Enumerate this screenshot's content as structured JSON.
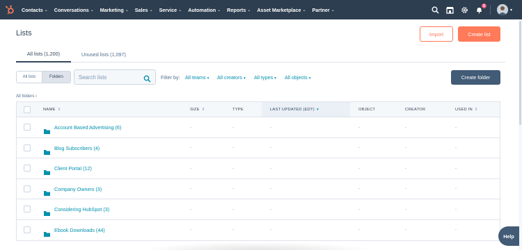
{
  "nav": {
    "items": [
      {
        "label": "Contacts",
        "id": "contacts"
      },
      {
        "label": "Conversations",
        "id": "conversations"
      },
      {
        "label": "Marketing",
        "id": "marketing"
      },
      {
        "label": "Sales",
        "id": "sales"
      },
      {
        "label": "Service",
        "id": "service"
      },
      {
        "label": "Automation",
        "id": "automation"
      },
      {
        "label": "Reports",
        "id": "reports"
      },
      {
        "label": "Asset Marketplace",
        "id": "asset-marketplace"
      },
      {
        "label": "Partner",
        "id": "partner"
      }
    ],
    "notification_count": "6",
    "brand_color": "#2d3e50",
    "accent_color": "#ff7a59"
  },
  "page": {
    "title": "Lists",
    "import_label": "Import",
    "create_list_label": "Create list"
  },
  "tabs": {
    "all": "All lists (1,200)",
    "unused": "Unused lists (1,097)"
  },
  "toolbar": {
    "view_lists": "All lists",
    "view_folders": "Folders",
    "search_placeholder": "Search lists",
    "filter_label": "Filter by:",
    "filters": [
      "All teams",
      "All creators",
      "All types",
      "All objects"
    ],
    "create_folder_label": "Create folder"
  },
  "breadcrumb": "All folders",
  "table": {
    "columns": {
      "name": "NAME",
      "size": "SIZE",
      "type": "TYPE",
      "updated": "LAST UPDATED (EDT)",
      "object": "OBJECT",
      "creator": "CREATOR",
      "used_in": "USED IN"
    },
    "rows": [
      {
        "name": "Account Based Advertising (6)",
        "size": "-",
        "type": "-",
        "updated": "-",
        "object": "-",
        "creator": "-",
        "used_in": "-"
      },
      {
        "name": "Blog Subscribers (4)",
        "size": "-",
        "type": "-",
        "updated": "-",
        "object": "-",
        "creator": "-",
        "used_in": "-"
      },
      {
        "name": "Client Portal (12)",
        "size": "-",
        "type": "-",
        "updated": "-",
        "object": "-",
        "creator": "-",
        "used_in": "-"
      },
      {
        "name": "Company Owners (3)",
        "size": "-",
        "type": "-",
        "updated": "-",
        "object": "-",
        "creator": "-",
        "used_in": "-"
      },
      {
        "name": "Considering HubSpot (3)",
        "size": "-",
        "type": "-",
        "updated": "-",
        "object": "-",
        "creator": "-",
        "used_in": "-"
      },
      {
        "name": "Ebook Downloads (44)",
        "size": "-",
        "type": "-",
        "updated": "-",
        "object": "-",
        "creator": "-",
        "used_in": "-"
      }
    ]
  },
  "help_label": "Help"
}
